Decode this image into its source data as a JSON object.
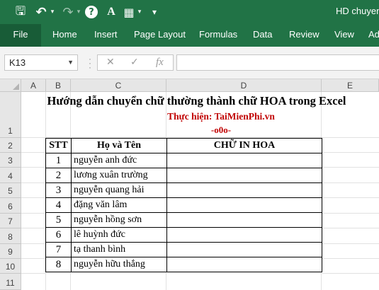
{
  "app": {
    "title": "HD chuyen",
    "accent_color": "#217346"
  },
  "qat": [
    {
      "name": "save-icon",
      "glyph": "🖫"
    },
    {
      "name": "undo-icon",
      "glyph": "↶"
    },
    {
      "name": "redo-icon",
      "glyph": "↷"
    },
    {
      "name": "help-icon",
      "glyph": "?"
    },
    {
      "name": "font-color-icon",
      "glyph": "A"
    },
    {
      "name": "borders-icon",
      "glyph": "▦"
    },
    {
      "name": "customize-qat-icon",
      "glyph": "▾"
    }
  ],
  "ribbon": {
    "tabs": [
      "File",
      "Home",
      "Insert",
      "Page Layout",
      "Formulas",
      "Data",
      "Review",
      "View",
      "Add"
    ]
  },
  "formula_bar": {
    "name_box": "K13",
    "cancel_glyph": "✕",
    "enter_glyph": "✓",
    "fx_glyph": "fx",
    "formula": ""
  },
  "columns": [
    "A",
    "B",
    "C",
    "D",
    "E"
  ],
  "rows": [
    "1",
    "2",
    "3",
    "4",
    "5",
    "6",
    "7",
    "8",
    "9",
    "10",
    "11"
  ],
  "sheet": {
    "title": "Hướng dẫn chuyển chữ thường thành chữ HOA trong Excel",
    "author": "Thực hiện: TaiMienPhi.vn",
    "divider": "-o0o-",
    "header": {
      "stt": "STT",
      "name": "Họ và Tên",
      "upper": "CHỮ IN HOA"
    },
    "entries": [
      {
        "stt": "1",
        "name": "nguyễn anh đức",
        "upper": ""
      },
      {
        "stt": "2",
        "name": "lương xuân trường",
        "upper": ""
      },
      {
        "stt": "3",
        "name": "nguyễn quang hải",
        "upper": ""
      },
      {
        "stt": "4",
        "name": "đặng văn lâm",
        "upper": ""
      },
      {
        "stt": "5",
        "name": "nguyễn hồng sơn",
        "upper": ""
      },
      {
        "stt": "6",
        "name": "lê huỳnh đức",
        "upper": ""
      },
      {
        "stt": "7",
        "name": "tạ thanh bình",
        "upper": ""
      },
      {
        "stt": "8",
        "name": "nguyễn hữu thắng",
        "upper": ""
      }
    ]
  }
}
